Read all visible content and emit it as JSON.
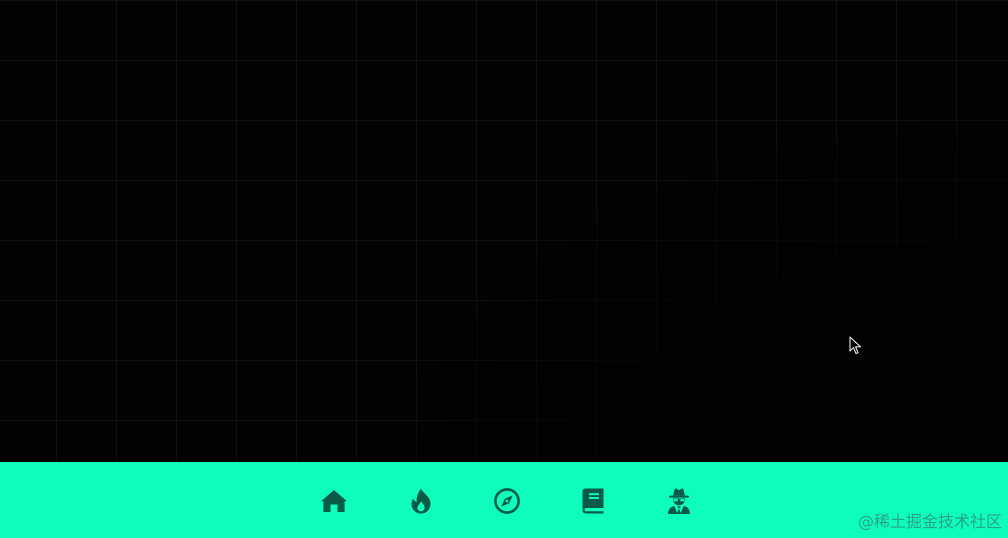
{
  "nav": {
    "items": [
      {
        "icon": "home-icon"
      },
      {
        "icon": "fire-icon"
      },
      {
        "icon": "compass-icon"
      },
      {
        "icon": "book-icon"
      },
      {
        "icon": "user-secret-icon"
      }
    ]
  },
  "colors": {
    "background": "#020203",
    "grid_line": "#1a1a1c",
    "bar": "#0efdbd",
    "icon": "#0a5a48"
  },
  "watermark": {
    "text": "@稀土掘金技术社区"
  }
}
